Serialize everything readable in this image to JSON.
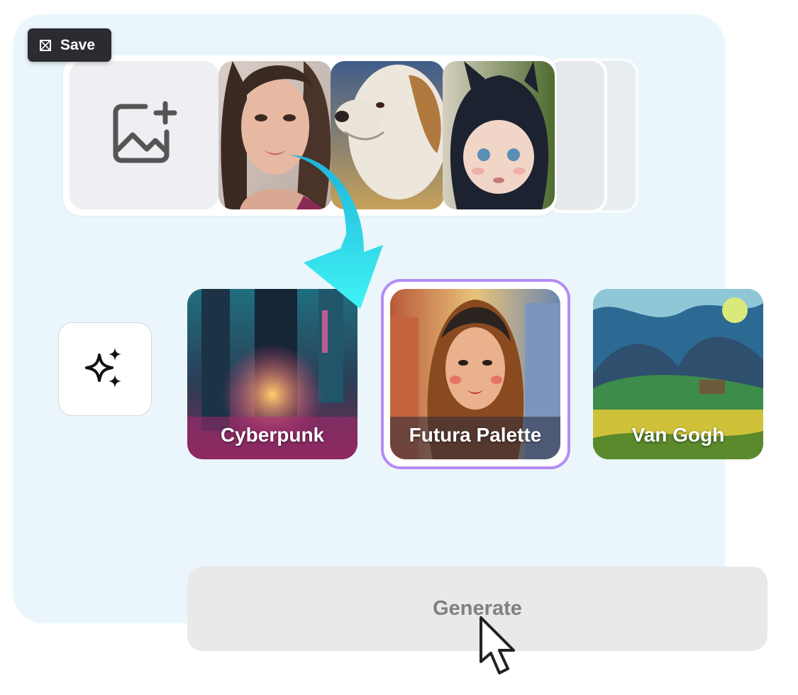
{
  "toolbar": {
    "save_label": "Save"
  },
  "uploads": {
    "add_icon": "image-plus-icon",
    "photos": [
      "woman-portrait",
      "dog-portrait",
      "baby-hood-portrait"
    ]
  },
  "styles": {
    "magic_icon": "sparkles-icon",
    "items": [
      {
        "label": "Cyberpunk",
        "selected": false
      },
      {
        "label": "Futura Palette",
        "selected": true
      },
      {
        "label": "Van Gogh",
        "selected": false
      }
    ],
    "selected_color": "#b58cf5"
  },
  "actions": {
    "generate_label": "Generate"
  },
  "colors": {
    "panel": "#eaf6fb",
    "arrow": "#2ee4f2",
    "save_bg": "#2b2b31"
  }
}
